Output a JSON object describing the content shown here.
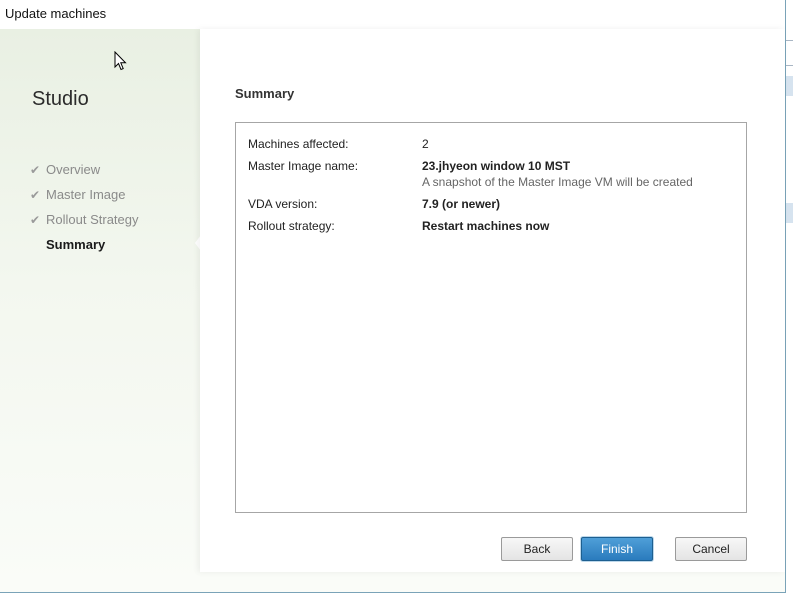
{
  "window": {
    "title": "Update machines"
  },
  "sidebar": {
    "app_title": "Studio",
    "steps": [
      {
        "label": "Overview",
        "completed": true
      },
      {
        "label": "Master Image",
        "completed": true
      },
      {
        "label": "Rollout Strategy",
        "completed": true
      },
      {
        "label": "Summary",
        "completed": false,
        "current": true
      }
    ]
  },
  "summary": {
    "title": "Summary",
    "rows": [
      {
        "label": "Machines affected:",
        "value": "2"
      },
      {
        "label": "Master Image name:",
        "value": "23.jhyeon window 10 MST",
        "note": "A snapshot of the Master Image VM will be created"
      },
      {
        "label": "VDA version:",
        "value": "7.9 (or newer)"
      },
      {
        "label": "Rollout strategy:",
        "value": "Restart machines now"
      }
    ]
  },
  "buttons": {
    "back": "Back",
    "finish": "Finish",
    "cancel": "Cancel"
  },
  "colors": {
    "primary_button": "#2a7bbd",
    "sidebar_gradient_top": "#e9f0e3",
    "check_mark": "#9a9a9a"
  },
  "icons": {
    "step_done": "check-icon",
    "pointer": "mouse-cursor-icon"
  }
}
